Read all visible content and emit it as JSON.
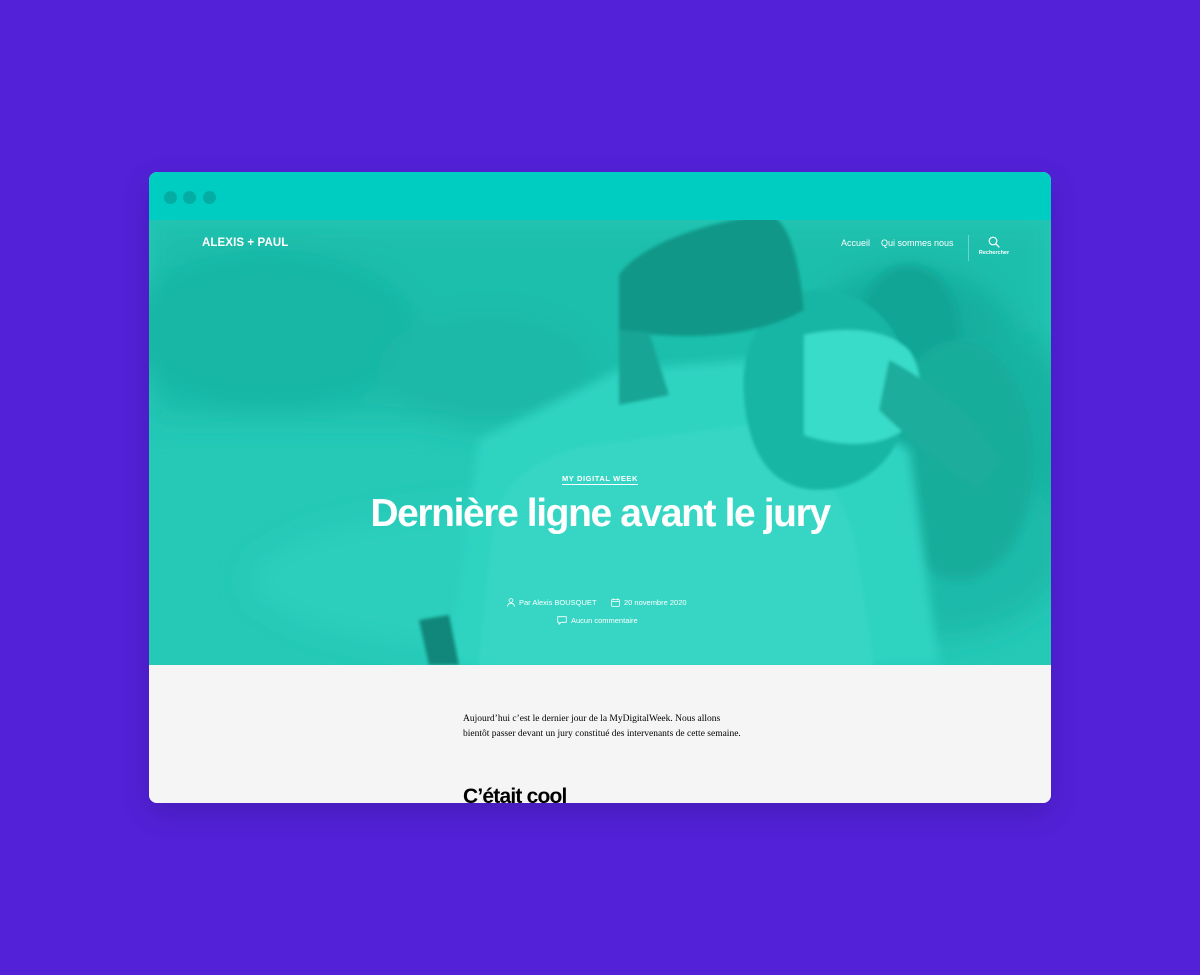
{
  "colors": {
    "page_background": "#5221d8",
    "titlebar": "#00cdc1",
    "titlebar_dots": "#04ada3",
    "hero_overlay": "#25c9b6",
    "content_background": "#f5f5f5"
  },
  "site": {
    "title": "ALEXIS + PAUL"
  },
  "nav": {
    "items": [
      {
        "label": "Accueil"
      },
      {
        "label": "Qui sommes nous"
      }
    ],
    "search": {
      "icon": "search-icon",
      "label": "Rechercher"
    }
  },
  "post": {
    "category": "MY DIGITAL WEEK",
    "title": "Dernière ligne avant le jury",
    "author": "Par Alexis BOUSQUET",
    "date": "20 novembre 2020",
    "comments": "Aucun commentaire",
    "author_icon": "user-icon",
    "date_icon": "calendar-icon",
    "comments_icon": "comment-icon"
  },
  "content": {
    "intro": "Aujourd’hui c’est le dernier jour de la MyDigitalWeek. Nous allons bientôt passer devant un jury constitué des intervenants de cette semaine.",
    "subheading": "C’était cool"
  }
}
